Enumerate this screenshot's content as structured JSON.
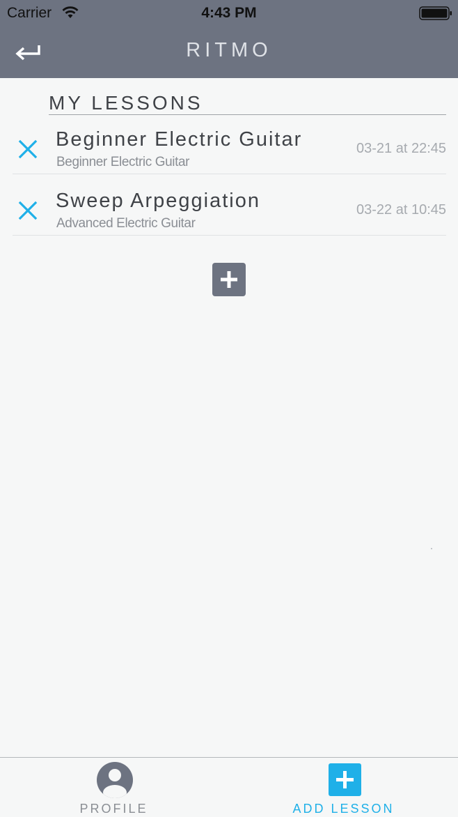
{
  "status_bar": {
    "carrier": "Carrier",
    "time": "4:43 PM",
    "wifi_icon": "wifi-icon",
    "battery_icon": "battery-icon"
  },
  "nav": {
    "title": "RITMO",
    "back_icon": "return-arrow-icon"
  },
  "section": {
    "title": "MY LESSONS"
  },
  "lessons": [
    {
      "name": "Beginner Electric Guitar",
      "subtitle": "Beginner Electric Guitar",
      "date": "03-21 at 22:45"
    },
    {
      "name": "Sweep Arpeggiation",
      "subtitle": "Advanced Electric Guitar",
      "date": "03-22 at 10:45"
    }
  ],
  "tabs": [
    {
      "label": "PROFILE",
      "icon": "person-icon"
    },
    {
      "label": "ADD LESSON",
      "icon": "plus-square-icon",
      "active": true
    }
  ],
  "colors": {
    "header_bg": "#6d7381",
    "accent": "#1fb0e8",
    "page_bg": "#f6f7f7",
    "text_primary": "#3f4247",
    "text_secondary": "#8a8e94"
  }
}
